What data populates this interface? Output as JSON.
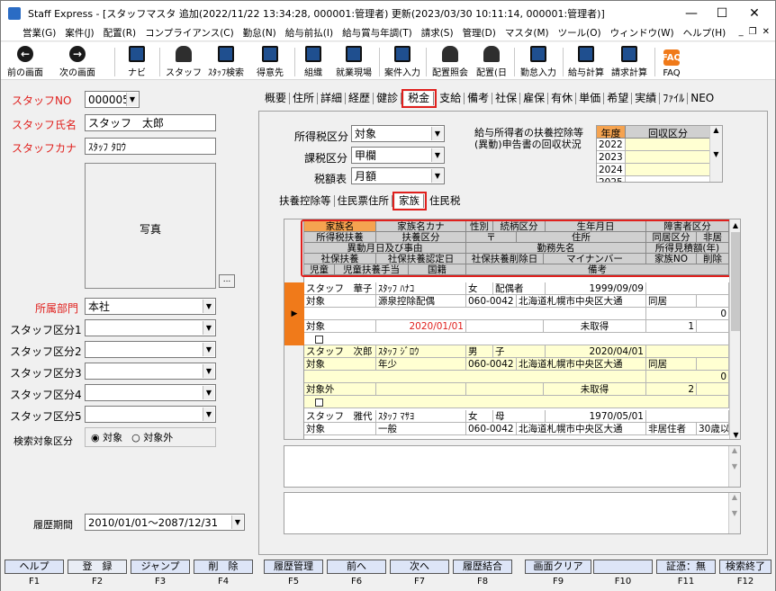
{
  "window": {
    "title": "Staff Express - [スタッフマスタ 追加(2022/11/22 13:34:28, 000001:管理者) 更新(2023/03/30 10:11:14, 000001:管理者)]",
    "minimize": "—",
    "maximize": "☐",
    "close": "✕"
  },
  "menu": [
    "営業(G)",
    "案件(J)",
    "配置(R)",
    "コンプライアンス(C)",
    "勤怠(N)",
    "給与前払(I)",
    "給与賞与年調(T)",
    "請求(S)",
    "管理(D)",
    "マスタ(M)",
    "ツール(O)",
    "ウィンドウ(W)",
    "ヘルプ(H)"
  ],
  "mdi_buttons": [
    "_",
    "❐",
    "✕"
  ],
  "toolbar": [
    {
      "label": "前の画面",
      "icon": "arrow-left-icon",
      "glyph": "←"
    },
    {
      "label": "次の画面",
      "icon": "arrow-right-icon",
      "glyph": "→"
    },
    {
      "label": "ナビ",
      "icon": "navi-icon",
      "glyph": ""
    },
    {
      "label": "スタッフ",
      "icon": "staff-icon",
      "glyph": ""
    },
    {
      "label": "ｽﾀｯﾌ検索",
      "icon": "staff-search-icon",
      "glyph": ""
    },
    {
      "label": "得意先",
      "icon": "customer-icon",
      "glyph": ""
    },
    {
      "label": "組織",
      "icon": "organization-icon",
      "glyph": ""
    },
    {
      "label": "就業現場",
      "icon": "workplace-icon",
      "glyph": ""
    },
    {
      "label": "案件入力",
      "icon": "project-input-icon",
      "glyph": ""
    },
    {
      "label": "配置照会",
      "icon": "assignment-inquiry-icon",
      "glyph": ""
    },
    {
      "label": "配置(日",
      "icon": "assignment-daily-icon",
      "glyph": ""
    },
    {
      "label": "勤怠入力",
      "icon": "attendance-input-icon",
      "glyph": ""
    },
    {
      "label": "給与計算",
      "icon": "payroll-icon",
      "glyph": ""
    },
    {
      "label": "請求計算",
      "icon": "billing-icon",
      "glyph": ""
    },
    {
      "label": "FAQ",
      "icon": "faq-icon",
      "glyph": "FAQ"
    }
  ],
  "left": {
    "staff_no_label": "スタッフNO",
    "staff_no": "000005",
    "staff_name_label": "スタッフ氏名",
    "staff_name": "スタッフ　太郎",
    "staff_kana_label": "スタッフカナ",
    "staff_kana": "ｽﾀｯﾌ ﾀﾛｳ",
    "photo_label": "写真",
    "photo_button": "...",
    "dept_label": "所属部門",
    "dept": "本社",
    "kubun_labels": [
      "スタッフ区分1",
      "スタッフ区分2",
      "スタッフ区分3",
      "スタッフ区分4",
      "スタッフ区分5"
    ],
    "search_target_label": "検索対象区分",
    "search_target_options": [
      "対象",
      "対象外"
    ],
    "history_label": "履歴期間",
    "history_value": "2010/01/01〜2087/12/31"
  },
  "main_tabs": [
    "概要",
    "住所",
    "詳細",
    "経歴",
    "健診",
    "税金",
    "支給",
    "備考",
    "社保",
    "雇保",
    "有休",
    "単価",
    "希望",
    "実績",
    "ﾌｧｲﾙ",
    "NEO"
  ],
  "main_tab_selected": "税金",
  "tax": {
    "shotoku_label": "所得税区分",
    "shotoku": "対象",
    "kazei_label": "課税区分",
    "kazei": "甲欄",
    "gakuhyo_label": "税額表",
    "gakuhyo": "月額",
    "fuyo_note": "給与所得者の扶養控除等(異動)申告書の回収状況",
    "year_col": "年度",
    "collect_col": "回収区分",
    "years": [
      "2022",
      "2023",
      "2024",
      "2025"
    ]
  },
  "sub_tabs": [
    "扶養控除等",
    "住民票住所",
    "家族",
    "住民税"
  ],
  "sub_tab_selected": "家族",
  "grid_headers": {
    "r1": [
      "家族名",
      "家族名カナ",
      "性別",
      "続柄区分",
      "生年月日",
      "障害者区分"
    ],
    "r2": [
      "所得税扶養",
      "扶養区分",
      "〒",
      "住所",
      "同居区分",
      "非居"
    ],
    "r3": [
      "異動月日及び事由",
      "勤務先名",
      "所得見積額(年)"
    ],
    "r4": [
      "社保扶養",
      "社保扶養認定日",
      "社保扶養削除日",
      "マイナンバー",
      "家族NO",
      "削除"
    ],
    "r5": [
      "児童",
      "児童扶養手当",
      "国籍",
      "備考"
    ]
  },
  "records": [
    {
      "name": "スタッフ　華子",
      "kana": "ｽﾀｯﾌ ﾊﾅｺ",
      "gender": "女",
      "relation": "配偶者",
      "birth": "1999/09/09",
      "tax_fuyo": "対象",
      "fuyo_kubun": "源泉控除配偶",
      "zip": "060-0042",
      "address": "北海道札幌市中央区大通",
      "dokyo": "同居",
      "income": "0",
      "shaho": "対象",
      "shaho_date": "2020/01/01",
      "mynumber": "未取得",
      "family_no": "1"
    },
    {
      "name": "スタッフ　次郎",
      "kana": "ｽﾀｯﾌ ｼﾞﾛｳ",
      "gender": "男",
      "relation": "子",
      "birth": "2020/04/01",
      "tax_fuyo": "対象",
      "fuyo_kubun": "年少",
      "zip": "060-0042",
      "address": "北海道札幌市中央区大通",
      "dokyo": "同居",
      "income": "0",
      "shaho": "対象外",
      "shaho_date": "",
      "mynumber": "未取得",
      "family_no": "2"
    },
    {
      "name": "スタッフ　雅代",
      "kana": "ｽﾀｯﾌ ﾏｻﾖ",
      "gender": "女",
      "relation": "母",
      "birth": "1970/05/01",
      "tax_fuyo": "対象",
      "fuyo_kubun": "一般",
      "zip": "060-0042",
      "address": "北海道札幌市中央区大通",
      "dokyo": "非居住者",
      "extra": "30歳以"
    }
  ],
  "fkeys": [
    {
      "label": "ヘルプ",
      "key": "F1"
    },
    {
      "label": "登　録",
      "key": "F2"
    },
    {
      "label": "ジャンプ",
      "key": "F3"
    },
    {
      "label": "削　除",
      "key": "F4"
    },
    {
      "label": "履歴管理",
      "key": "F5"
    },
    {
      "label": "前へ",
      "key": "F6"
    },
    {
      "label": "次へ",
      "key": "F7"
    },
    {
      "label": "履歴結合",
      "key": "F8"
    },
    {
      "label": "画面クリア",
      "key": "F9"
    },
    {
      "label": "",
      "key": "F10"
    },
    {
      "label": "証憑：無",
      "key": "F11"
    },
    {
      "label": "検索終了",
      "key": "F12"
    }
  ],
  "colors": {
    "accent_red": "#e0201d",
    "highlight_orange": "#f5a350",
    "row_yellow": "#ffffd2",
    "fkey_blue": "#dde5f7"
  }
}
